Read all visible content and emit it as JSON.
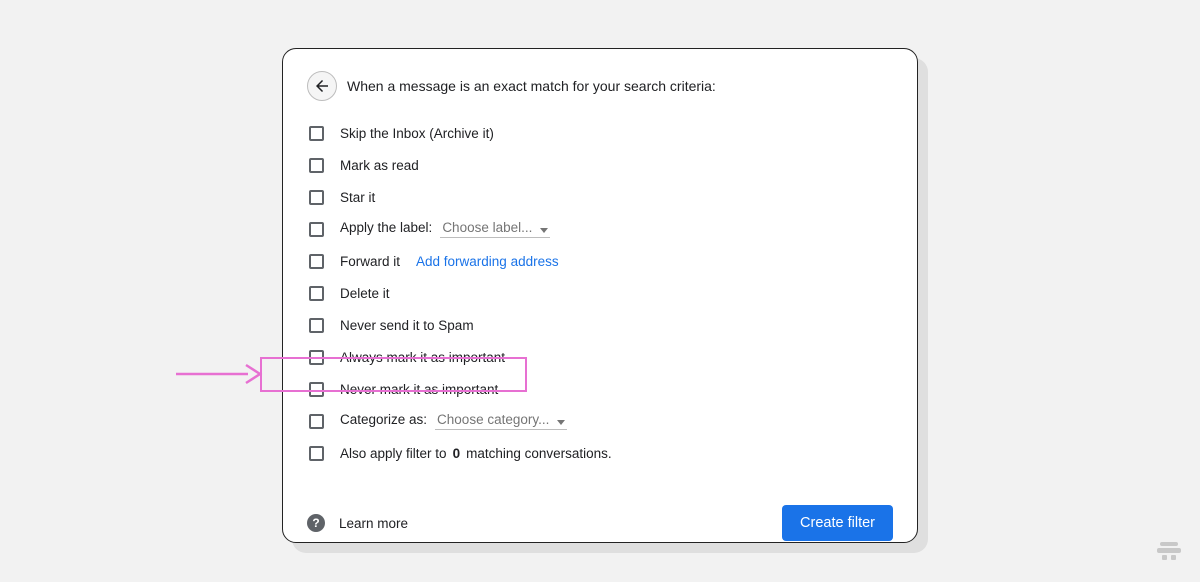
{
  "header": "When a message is an exact match for your search criteria:",
  "options": {
    "skip_inbox": "Skip the Inbox (Archive it)",
    "mark_read": "Mark as read",
    "star": "Star it",
    "apply_label_prefix": "Apply the label:",
    "apply_label_choice": "Choose label...",
    "forward_prefix": "Forward it",
    "forward_link": "Add forwarding address",
    "delete": "Delete it",
    "never_spam": "Never send it to Spam",
    "always_important": "Always mark it as important",
    "never_important": "Never mark it as important",
    "categorize_prefix": "Categorize as:",
    "categorize_choice": "Choose category...",
    "also_apply_prefix": "Also apply filter to ",
    "also_apply_count": "0",
    "also_apply_suffix": " matching conversations."
  },
  "footer": {
    "learn_more": "Learn more",
    "create": "Create filter"
  }
}
